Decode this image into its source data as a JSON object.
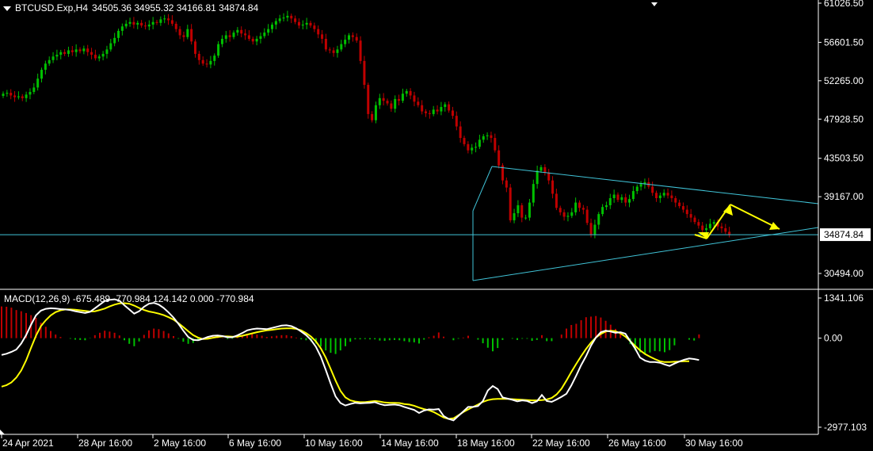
{
  "header": {
    "symbol": "BTCUSD.Exp,H4",
    "ohlc": "34505.36 34955.32 34166.81 34874.84"
  },
  "macd_header": "MACD(12,26,9) -675.489 -770.984 124.142 0.000 -770.984",
  "colors": {
    "background": "#000000",
    "bull": "#00c000",
    "bear": "#c00000",
    "trendline": "#40c4d8",
    "arrow": "#ffff00",
    "macd_line": "#ffffff",
    "signal_line": "#ffff00",
    "text": "#ffffff"
  },
  "chart_data": [
    {
      "type": "candlestick",
      "title": "BTCUSD.Exp,H4",
      "price_axis_labels": [
        "61026.50",
        "56601.50",
        "52265.00",
        "47928.50",
        "43503.50",
        "39167.00",
        "34874.84",
        "30494.00"
      ],
      "current_price": "34874.84",
      "ylim": [
        28900,
        61400
      ],
      "x_ticks": [
        "24 Apr 2021",
        "28 Apr 16:00",
        "2 May 16:00",
        "6 May 16:00",
        "10 May 16:00",
        "14 May 16:00",
        "18 May 16:00",
        "22 May 16:00",
        "26 May 16:00",
        "30 May 16:00"
      ],
      "closes": [
        50800,
        50900,
        50600,
        50400,
        50500,
        50300,
        50700,
        51000,
        51500,
        52500,
        53500,
        54200,
        54600,
        55000,
        55200,
        55500,
        55300,
        55700,
        55500,
        55800,
        55600,
        55900,
        55500,
        55200,
        54800,
        55000,
        55300,
        55800,
        56500,
        57100,
        57900,
        58400,
        58700,
        58900,
        58600,
        58800,
        58500,
        58400,
        58600,
        58900,
        58800,
        59200,
        59300,
        59100,
        58700,
        58100,
        57400,
        57200,
        58100,
        56700,
        55300,
        54600,
        54200,
        54100,
        54500,
        55100,
        56400,
        57000,
        57400,
        57200,
        57700,
        58000,
        57600,
        57400,
        57000,
        56700,
        57000,
        57300,
        57700,
        58100,
        58600,
        59000,
        59300,
        59400,
        59600,
        59300,
        58900,
        58500,
        58600,
        58800,
        58500,
        58100,
        57500,
        57000,
        55800,
        55700,
        55400,
        55800,
        56400,
        56900,
        57400,
        57200,
        56800,
        54500,
        51800,
        48500,
        47800,
        49500,
        50300,
        50000,
        49700,
        49100,
        50200,
        50000,
        50800,
        51100,
        50600,
        49900,
        49500,
        48800,
        48600,
        48500,
        49000,
        48800,
        49300,
        49600,
        48900,
        48300,
        47100,
        45800,
        45100,
        44400,
        44700,
        44800,
        45600,
        46000,
        46100,
        45800,
        44400,
        42700,
        41000,
        40200,
        36500,
        37300,
        38200,
        36800,
        36800,
        38500,
        40600,
        42100,
        42500,
        41900,
        41000,
        39500,
        37900,
        37400,
        36900,
        37000,
        37400,
        38500,
        37900,
        37700,
        36200,
        34900,
        36000,
        37200,
        38000,
        38200,
        39000,
        39400,
        38800,
        39100,
        38500,
        38900,
        39800,
        40300,
        40600,
        40800,
        40300,
        39600,
        39000,
        39300,
        39600,
        39300,
        39000,
        38500,
        38100,
        37700,
        37200,
        36800,
        36300,
        35900,
        35400,
        35600,
        36100,
        36300,
        35800,
        35600,
        35200,
        34900
      ],
      "annotations": [
        "symmetrical triangle trendlines",
        "horizontal line at current price 34874.84",
        "projected path arrows"
      ]
    },
    {
      "type": "line",
      "title": "MACD(12,26,9)",
      "series": [
        {
          "name": "MACD",
          "values": [
            -560,
            -520,
            -460,
            -380,
            -180,
            100,
            450,
            760,
            920,
            980,
            1000,
            990,
            970,
            960,
            940,
            900,
            870,
            840,
            880,
            1000,
            1120,
            1240,
            1280,
            1300,
            1250,
            1100,
            960,
            820,
            900,
            1050,
            1150,
            1180,
            1120,
            1010,
            860,
            690,
            480,
            250,
            40,
            -60,
            -70,
            -20,
            40,
            80,
            90,
            70,
            30,
            30,
            90,
            170,
            260,
            300,
            320,
            310,
            300,
            340,
            380,
            420,
            430,
            400,
            330,
            220,
            100,
            -60,
            -290,
            -620,
            -1060,
            -1520,
            -1950,
            -2170,
            -2250,
            -2200,
            -2160,
            -2180,
            -2170,
            -2160,
            -2140,
            -2200,
            -2240,
            -2230,
            -2220,
            -2240,
            -2300,
            -2350,
            -2400,
            -2500,
            -2420,
            -2380,
            -2390,
            -2370,
            -2600,
            -2700,
            -2750,
            -2600,
            -2450,
            -2300,
            -2300,
            -2270,
            -2100,
            -1750,
            -1600,
            -1700,
            -1980,
            -2020,
            -2060,
            -2110,
            -2080,
            -2100,
            -2170,
            -2110,
            -1900,
            -2100,
            -2130,
            -2050,
            -1960,
            -1860,
            -1580,
            -1250,
            -900,
            -600,
            -250,
            20,
            200,
            250,
            220,
            180,
            200,
            150,
            -100,
            -350,
            -650,
            -750,
            -800,
            -800,
            -820,
            -880,
            -930,
            -850,
            -780,
            -720,
            -680,
            -700,
            -730
          ]
        },
        {
          "name": "Signal",
          "values": [
            -1620,
            -1570,
            -1480,
            -1320,
            -1080,
            -740,
            -320,
            80,
            400,
            600,
            760,
            870,
            930,
            960,
            960,
            950,
            930,
            910,
            890,
            900,
            940,
            990,
            1060,
            1120,
            1160,
            1170,
            1150,
            1090,
            1010,
            940,
            890,
            860,
            820,
            770,
            700,
            620,
            500,
            370,
            230,
            100,
            20,
            -30,
            -20,
            10,
            40,
            60,
            60,
            50,
            50,
            80,
            120,
            160,
            200,
            230,
            260,
            280,
            300,
            320,
            330,
            330,
            310,
            260,
            170,
            50,
            -110,
            -340,
            -650,
            -1030,
            -1420,
            -1760,
            -1980,
            -2080,
            -2120,
            -2140,
            -2140,
            -2120,
            -2100,
            -2120,
            -2150,
            -2160,
            -2160,
            -2170,
            -2200,
            -2220,
            -2260,
            -2320,
            -2370,
            -2410,
            -2470,
            -2560,
            -2650,
            -2700,
            -2680,
            -2580,
            -2470,
            -2380,
            -2300,
            -2220,
            -2130,
            -2070,
            -2040,
            -2030,
            -2030,
            -2030,
            -2040,
            -2050,
            -2060,
            -2070,
            -2080,
            -2080,
            -2070,
            -2050,
            -2000,
            -1880,
            -1690,
            -1420,
            -1130,
            -860,
            -600,
            -360,
            -150,
            20,
            140,
            220,
            250,
            230,
            160,
            50,
            -100,
            -260,
            -410,
            -530,
            -620,
            -700,
            -770,
            -800,
            -800,
            -790,
            -780,
            -771,
            -771
          ]
        },
        {
          "name": "Histogram",
          "values": [
            1060,
            1050,
            1020,
            940,
            900,
            840,
            770,
            680,
            520,
            380,
            240,
            120,
            40,
            0,
            -20,
            -50,
            -60,
            -70,
            -10,
            100,
            180,
            250,
            220,
            180,
            90,
            -70,
            -190,
            -270,
            -110,
            110,
            260,
            320,
            300,
            240,
            160,
            70,
            -20,
            -120,
            -190,
            -160,
            -90,
            10,
            60,
            70,
            50,
            10,
            -30,
            -20,
            40,
            90,
            140,
            140,
            120,
            80,
            40,
            60,
            80,
            100,
            100,
            70,
            20,
            -40,
            -70,
            -110,
            -180,
            -280,
            -410,
            -490,
            -530,
            -410,
            -270,
            -120,
            -40,
            -40,
            -30,
            -40,
            -40,
            -80,
            -90,
            -70,
            -60,
            -70,
            -100,
            -130,
            -140,
            -180,
            -50,
            30,
            80,
            190,
            50,
            0,
            -70,
            -20,
            20,
            80,
            0,
            -50,
            -170,
            -320,
            -440,
            -330,
            -60,
            0,
            -20,
            -60,
            -20,
            -20,
            -90,
            -60,
            100,
            -100,
            -100,
            0,
            120,
            320,
            440,
            480,
            600,
            700,
            720,
            740,
            690,
            580,
            450,
            310,
            200,
            0,
            -200,
            -410,
            -480,
            -520,
            -480,
            -430,
            -440,
            -470,
            -400,
            -240,
            0,
            0,
            -50,
            -80,
            124
          ]
        }
      ],
      "axis_labels": [
        "1341.106",
        "0.00",
        "-2977.103"
      ],
      "ylim": [
        -3050,
        1400
      ]
    }
  ]
}
